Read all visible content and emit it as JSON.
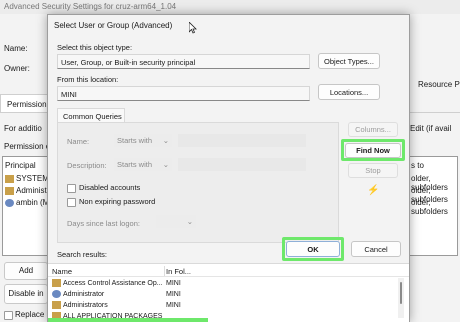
{
  "background": {
    "title": "Advanced Security Settings for cruz-arm64_1.04",
    "name_label": "Name:",
    "owner_label": "Owner:",
    "resource_label": "Resource P",
    "tab_permissions": "Permissions",
    "for_additional": "For additio",
    "edit_text": "Edit (if avail",
    "permission_entries": "Permission e",
    "principal_header": "Principal",
    "principals": [
      "SYSTEM",
      "Administr",
      "ambin (MI"
    ],
    "applies_to": [
      "s to",
      "older, subfolders",
      "older, subfolders",
      "older, subfolders"
    ],
    "add_button": "Add",
    "disable_button": "Disable in",
    "replace_label": "Replace al"
  },
  "dialog": {
    "title": "Select User or Group (Advanced)",
    "object_type_label": "Select this object type:",
    "object_type_value": "User, Group, or Built-in security principal",
    "object_types_button": "Object Types...",
    "location_label": "From this location:",
    "location_value": "MINI",
    "locations_button": "Locations...",
    "common_queries_tab": "Common Queries",
    "name_label": "Name:",
    "name_mode": "Starts with",
    "description_label": "Description:",
    "description_mode": "Starts with",
    "disabled_accounts": "Disabled accounts",
    "non_expiring": "Non expiring password",
    "days_label": "Days since last logon:",
    "columns_button": "Columns...",
    "find_now_button": "Find Now",
    "stop_button": "Stop",
    "search_results_label": "Search results:",
    "ok_button": "OK",
    "cancel_button": "Cancel",
    "col_name": "Name",
    "col_folder": "In Fol...",
    "results": [
      {
        "name": "Access Control Assistance Op...",
        "folder": "MINI"
      },
      {
        "name": "Administrator",
        "folder": "MINI"
      },
      {
        "name": "Administrators",
        "folder": "MINI"
      },
      {
        "name": "ALL APPLICATION PACKAGES",
        "folder": ""
      }
    ]
  },
  "colors": {
    "highlight": "#6ee86b"
  }
}
